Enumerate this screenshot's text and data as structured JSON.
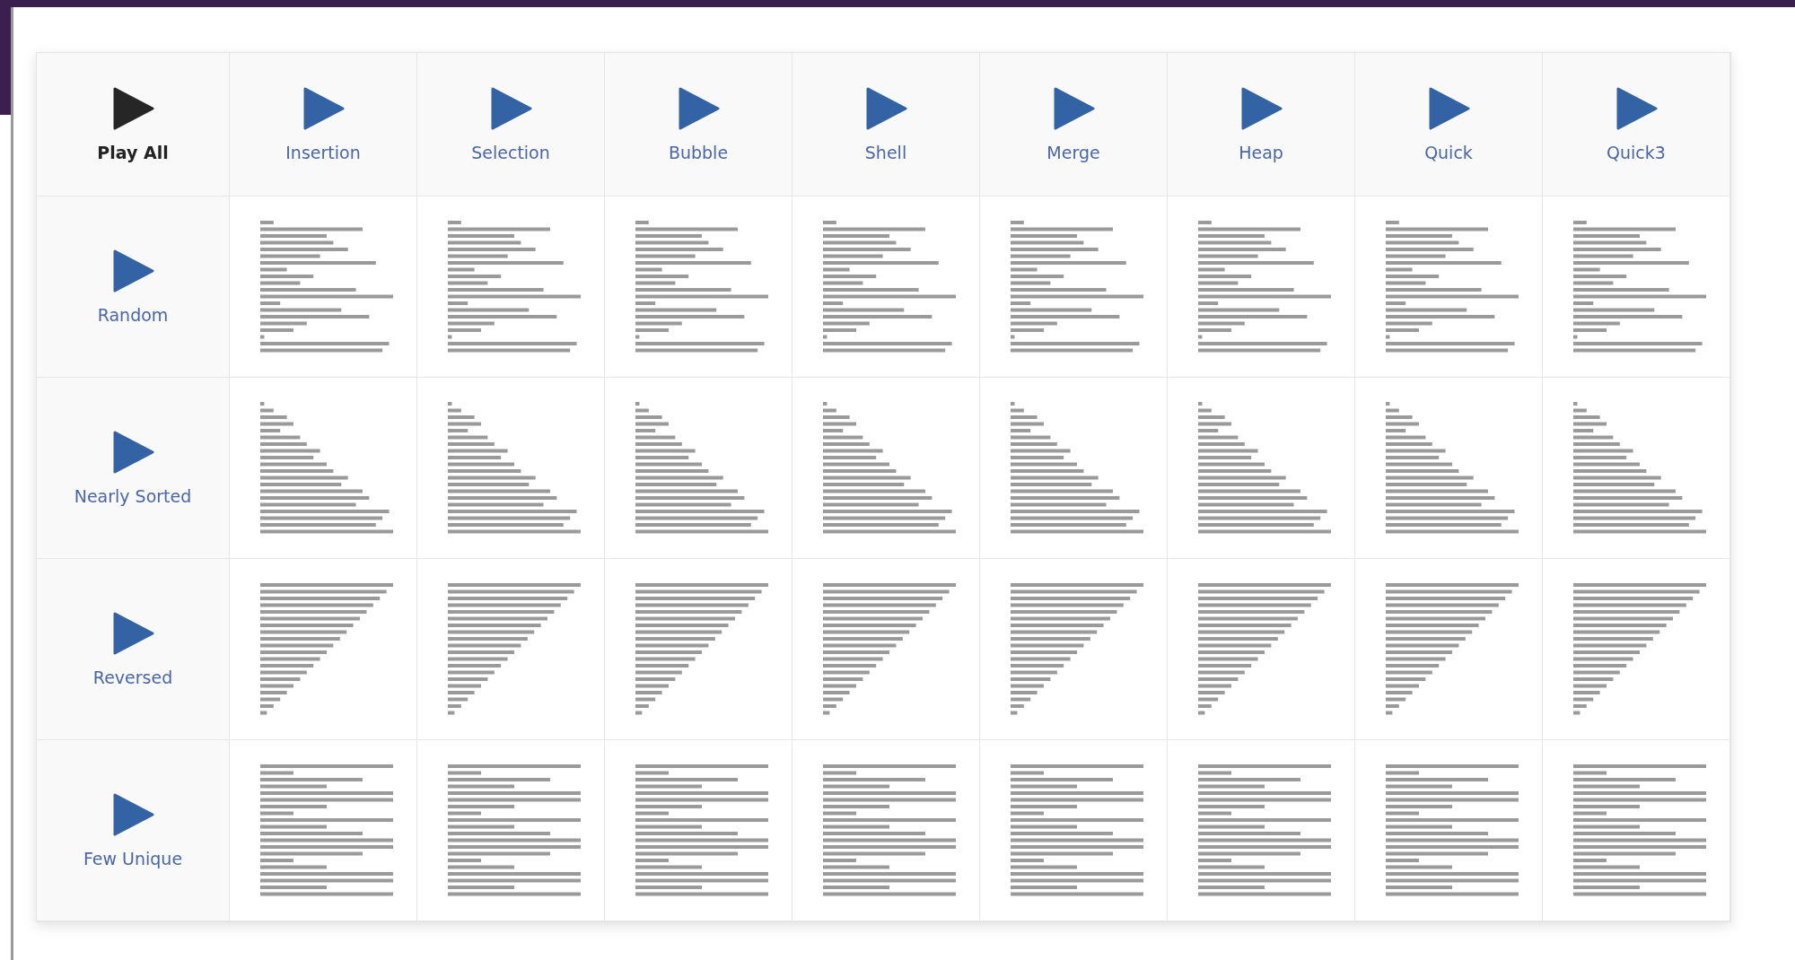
{
  "play_all": {
    "label": "Play All"
  },
  "algorithms": [
    {
      "label": "Insertion"
    },
    {
      "label": "Selection"
    },
    {
      "label": "Bubble"
    },
    {
      "label": "Shell"
    },
    {
      "label": "Merge"
    },
    {
      "label": "Heap"
    },
    {
      "label": "Quick"
    },
    {
      "label": "Quick3"
    }
  ],
  "rows": [
    {
      "label": "Random",
      "kind": "random"
    },
    {
      "label": "Nearly Sorted",
      "kind": "nearly_sorted"
    },
    {
      "label": "Reversed",
      "kind": "reversed"
    },
    {
      "label": "Few Unique",
      "kind": "few_unique"
    }
  ]
}
